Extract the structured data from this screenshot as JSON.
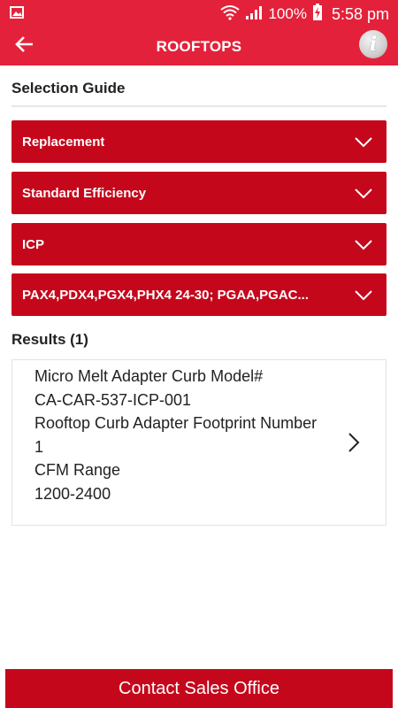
{
  "status_bar": {
    "battery": "100%",
    "time": "5:58 pm"
  },
  "app_bar": {
    "title": "ROOFTOPS",
    "info_glyph": "i"
  },
  "selection_guide": {
    "title": "Selection Guide",
    "dropdowns": [
      {
        "label": "Replacement"
      },
      {
        "label": "Standard Efficiency"
      },
      {
        "label": "ICP"
      },
      {
        "label": "PAX4,PDX4,PGX4,PHX4 24-30; PGAA,PGAC..."
      }
    ]
  },
  "results": {
    "title": "Results (1)",
    "items": [
      {
        "lines": [
          "Micro Melt Adapter Curb Model#",
          "CA-CAR-537-ICP-001",
          "Rooftop Curb Adapter Footprint Number",
          "1",
          "CFM Range",
          "1200-2400"
        ]
      }
    ]
  },
  "footer": {
    "contact_label": "Contact Sales Office"
  },
  "colors": {
    "brand_red": "#e4213a",
    "dropdown_red": "#c5071c"
  },
  "icons": {
    "back": "arrow-left-icon",
    "info": "info-icon",
    "dropdown": "chevron-down-icon",
    "result": "chevron-right-icon",
    "wifi": "wifi-icon",
    "signal": "signal-icon",
    "battery": "battery-charging-icon",
    "gallery": "image-notification-icon"
  }
}
